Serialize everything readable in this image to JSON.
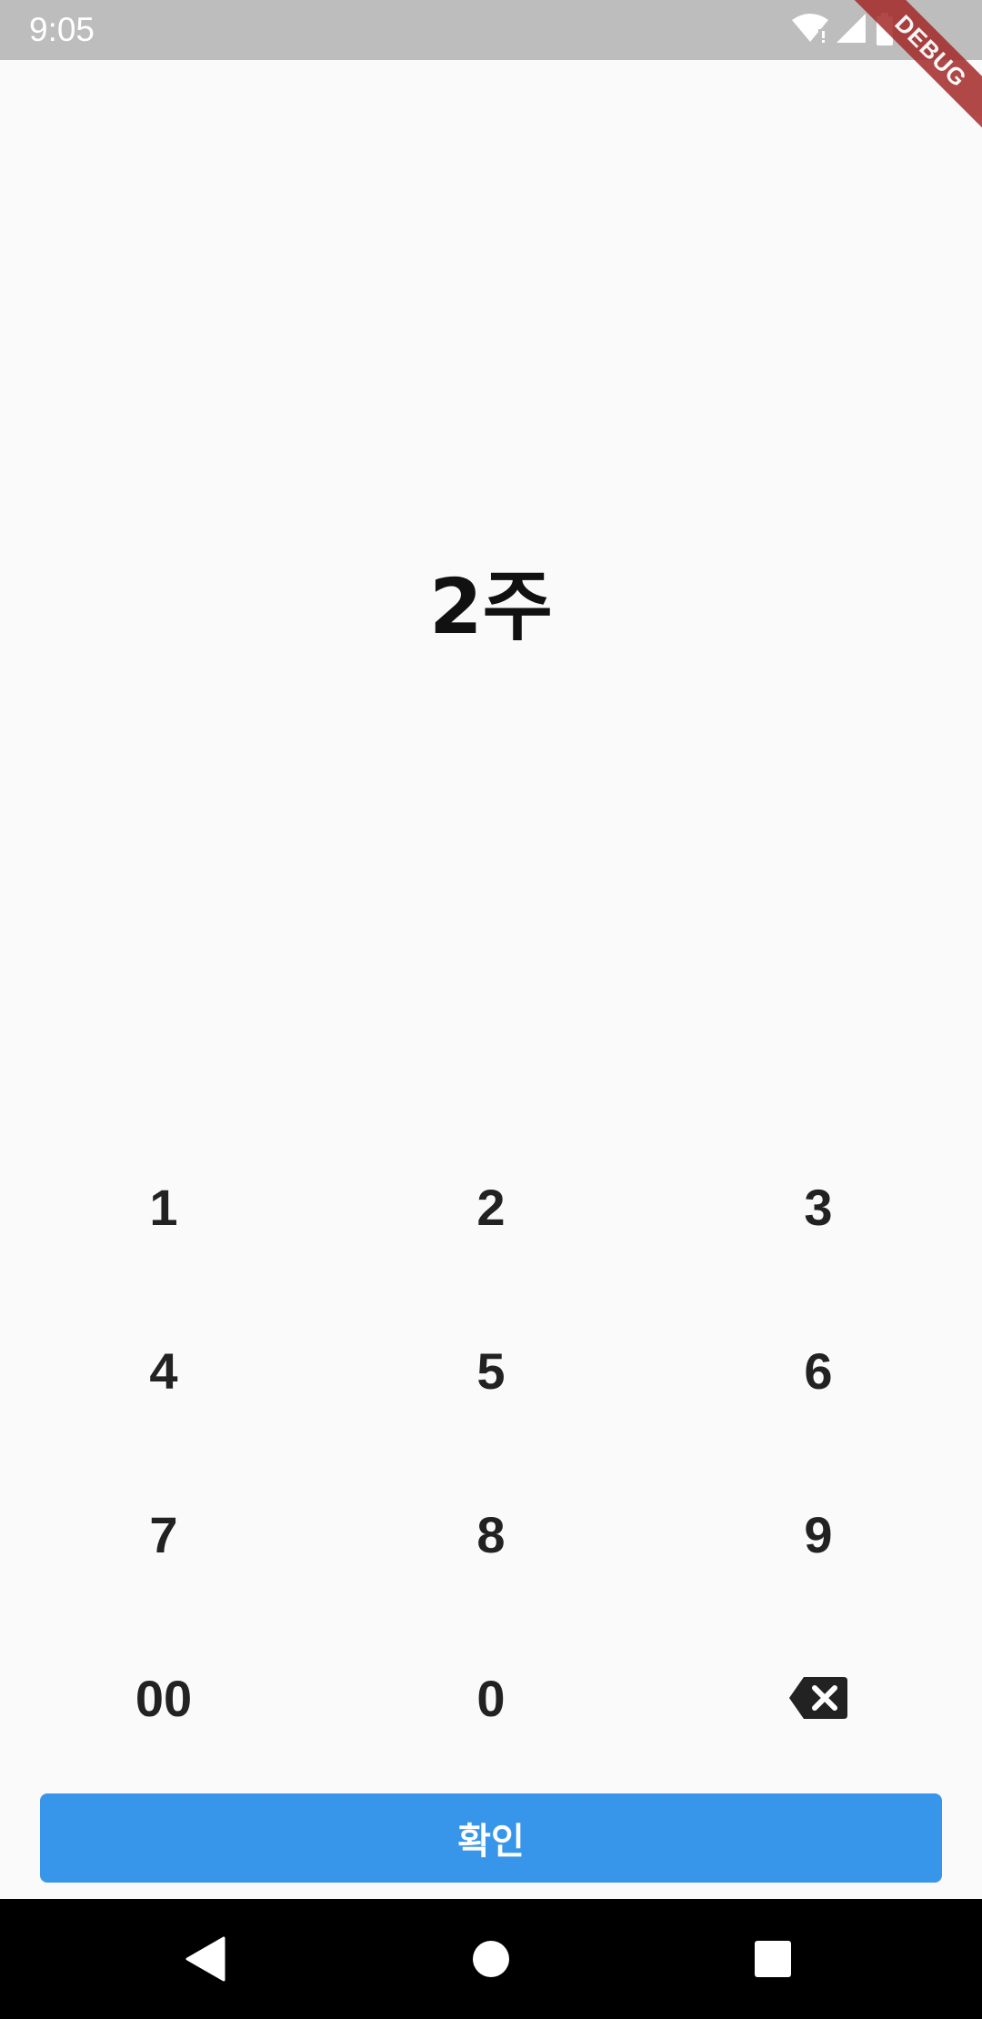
{
  "status_bar": {
    "time": "9:05",
    "icons": [
      "wifi-icon",
      "signal-icon",
      "battery-icon"
    ]
  },
  "debug_banner": {
    "label": "DEBUG",
    "color": "#a52a2a"
  },
  "display": {
    "value": "2주"
  },
  "keypad": {
    "keys": [
      "1",
      "2",
      "3",
      "4",
      "5",
      "6",
      "7",
      "8",
      "9",
      "00",
      "0"
    ],
    "backspace_icon": "backspace-icon"
  },
  "confirm": {
    "label": "확인",
    "color": "#3896ea"
  },
  "nav_bar": {
    "icons": [
      "back-icon",
      "home-icon",
      "recents-icon"
    ]
  }
}
